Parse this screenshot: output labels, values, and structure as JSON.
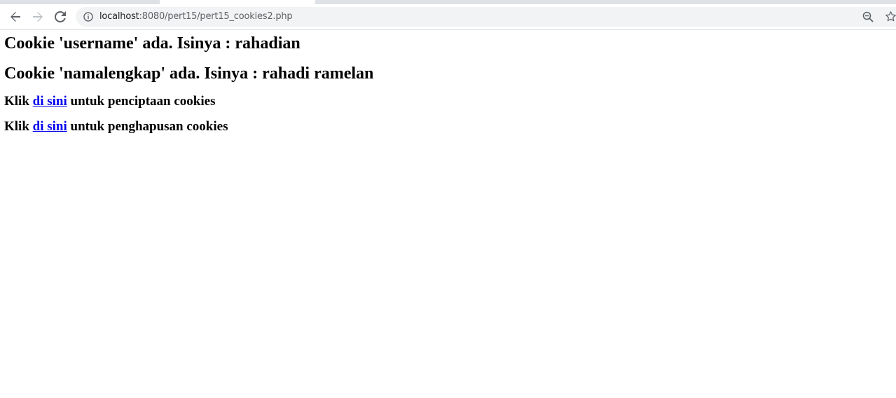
{
  "browser": {
    "url_host": "localhost",
    "url_path": ":8080/pert15/pert15_cookies2.php",
    "icons": {
      "back": "back-arrow-icon",
      "forward": "forward-arrow-icon",
      "reload": "reload-icon",
      "info": "info-icon",
      "zoom": "zoom-out-icon",
      "bookmark": "bookmark-star-icon"
    }
  },
  "content": {
    "username_line": "Cookie 'username' ada. Isinya : rahadian",
    "namalengkap_line": "Cookie 'namalengkap' ada. Isinya : rahadi ramelan",
    "create_line": {
      "prefix": "Klik ",
      "link": "di sini",
      "suffix": " untuk penciptaan cookies"
    },
    "delete_line": {
      "prefix": "Klik ",
      "link": "di sini",
      "suffix": " untuk penghapusan cookies"
    }
  },
  "colors": {
    "link": "#0000ee",
    "omnibox_bg": "#f1f3f4",
    "tab_strip": "#dee1e6"
  }
}
